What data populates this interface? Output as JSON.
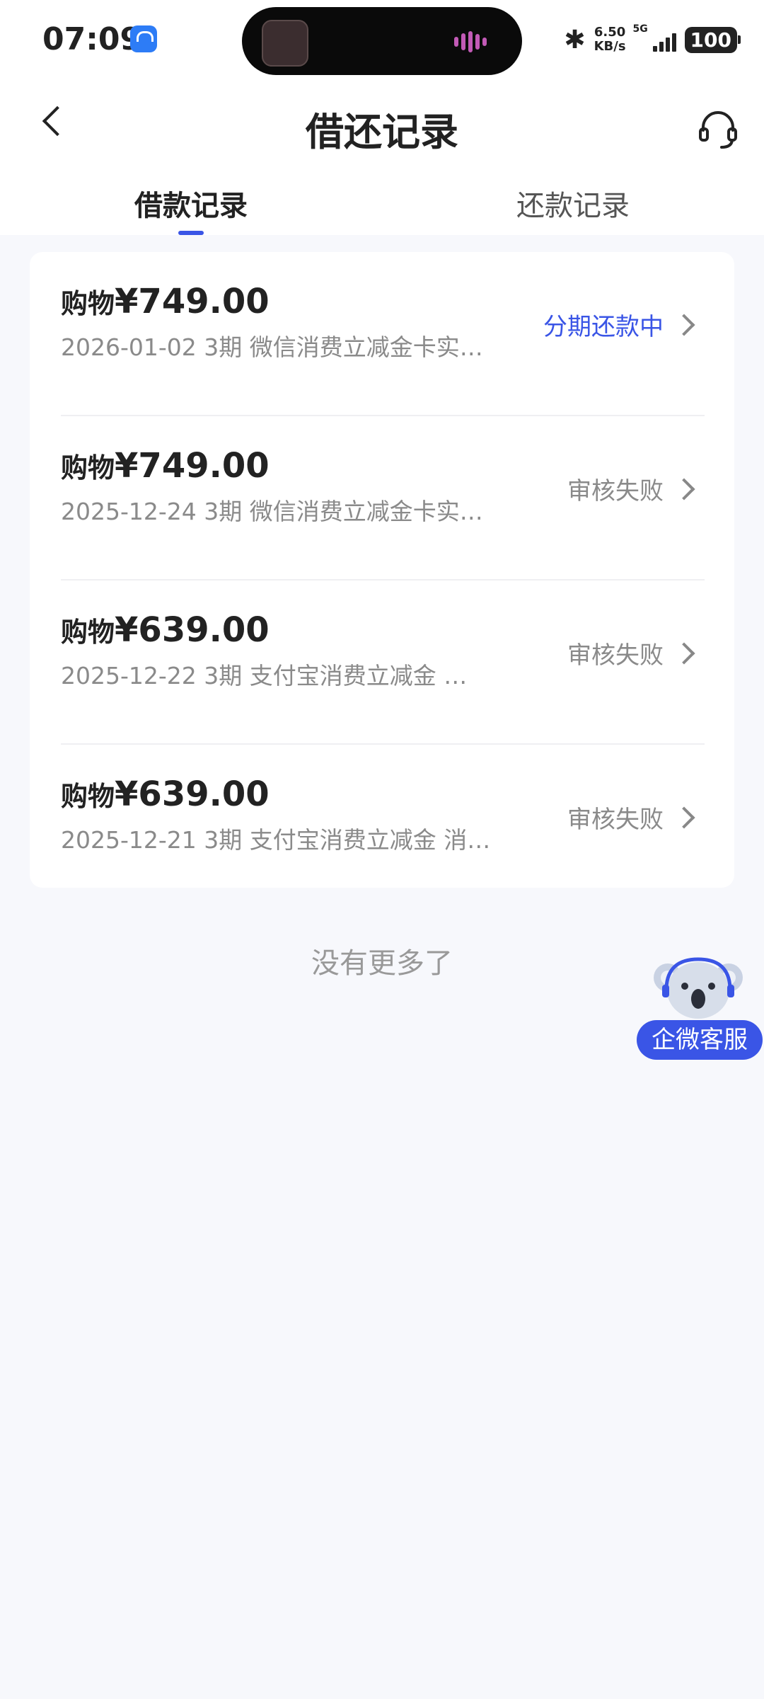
{
  "status_bar": {
    "time": "07:09",
    "net_speed_value": "6.50",
    "net_speed_unit": "KB/s",
    "network": "5G",
    "battery": "100"
  },
  "nav": {
    "title": "借还记录"
  },
  "tabs": [
    {
      "label": "借款记录",
      "active": true
    },
    {
      "label": "还款记录",
      "active": false
    }
  ],
  "records": [
    {
      "prefix": "购物",
      "amount": "¥749.00",
      "meta": "2026-01-02 3期  微信消费立减金卡实…",
      "status": "分期还款中",
      "status_active": true
    },
    {
      "prefix": "购物",
      "amount": "¥749.00",
      "meta": "2025-12-24 3期  微信消费立减金卡实…",
      "status": "审核失败",
      "status_active": false
    },
    {
      "prefix": "购物",
      "amount": "¥639.00",
      "meta": "2025-12-22 3期  支付宝消费立减金 …",
      "status": "审核失败",
      "status_active": false
    },
    {
      "prefix": "购物",
      "amount": "¥639.00",
      "meta": "2025-12-21 3期  支付宝消费立减金 消…",
      "status": "审核失败",
      "status_active": false
    }
  ],
  "footer": {
    "no_more": "没有更多了"
  },
  "floating_service": {
    "label": "企微客服"
  },
  "colors": {
    "accent": "#3A55E6",
    "background": "#F7F8FC",
    "muted_text": "#8A8A8A"
  },
  "icons": [
    "back-arrow-icon",
    "headset-icon",
    "chevron-right-icon",
    "bluetooth-icon",
    "signal-icon",
    "battery-icon",
    "koala-mascot-icon"
  ]
}
